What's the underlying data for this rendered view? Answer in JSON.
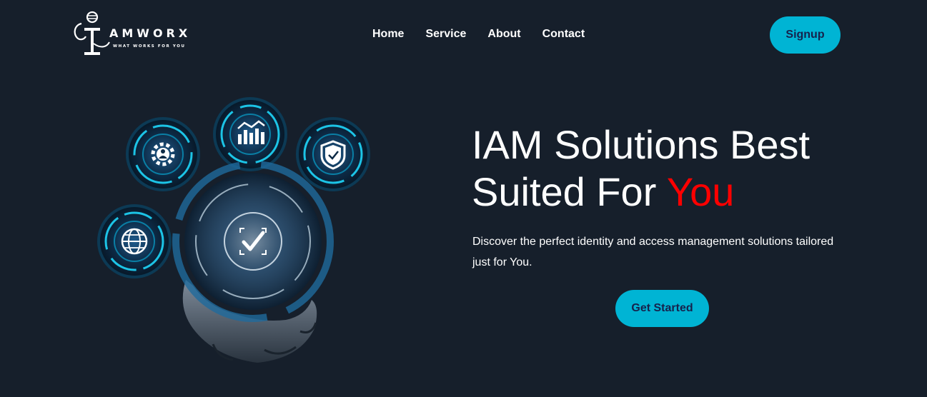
{
  "brand": {
    "name": "AMWORX",
    "tagline": "WHAT WORKS FOR YOU"
  },
  "nav": {
    "items": [
      "Home",
      "Service",
      "About",
      "Contact"
    ]
  },
  "header": {
    "signup_label": "Signup"
  },
  "hero": {
    "title_main": "IAM Solutions Best Suited For ",
    "title_accent": "You",
    "description": "Discover the perfect identity and access management solutions tailored just for You.",
    "cta_label": "Get Started"
  },
  "illustration": {
    "icons": [
      "gear-user-icon",
      "analytics-icon",
      "shield-check-icon",
      "globe-icon",
      "check-icon"
    ]
  },
  "colors": {
    "background": "#161f2b",
    "accent": "#00b4d4",
    "button_text": "#16224c",
    "highlight": "#ff0000"
  }
}
